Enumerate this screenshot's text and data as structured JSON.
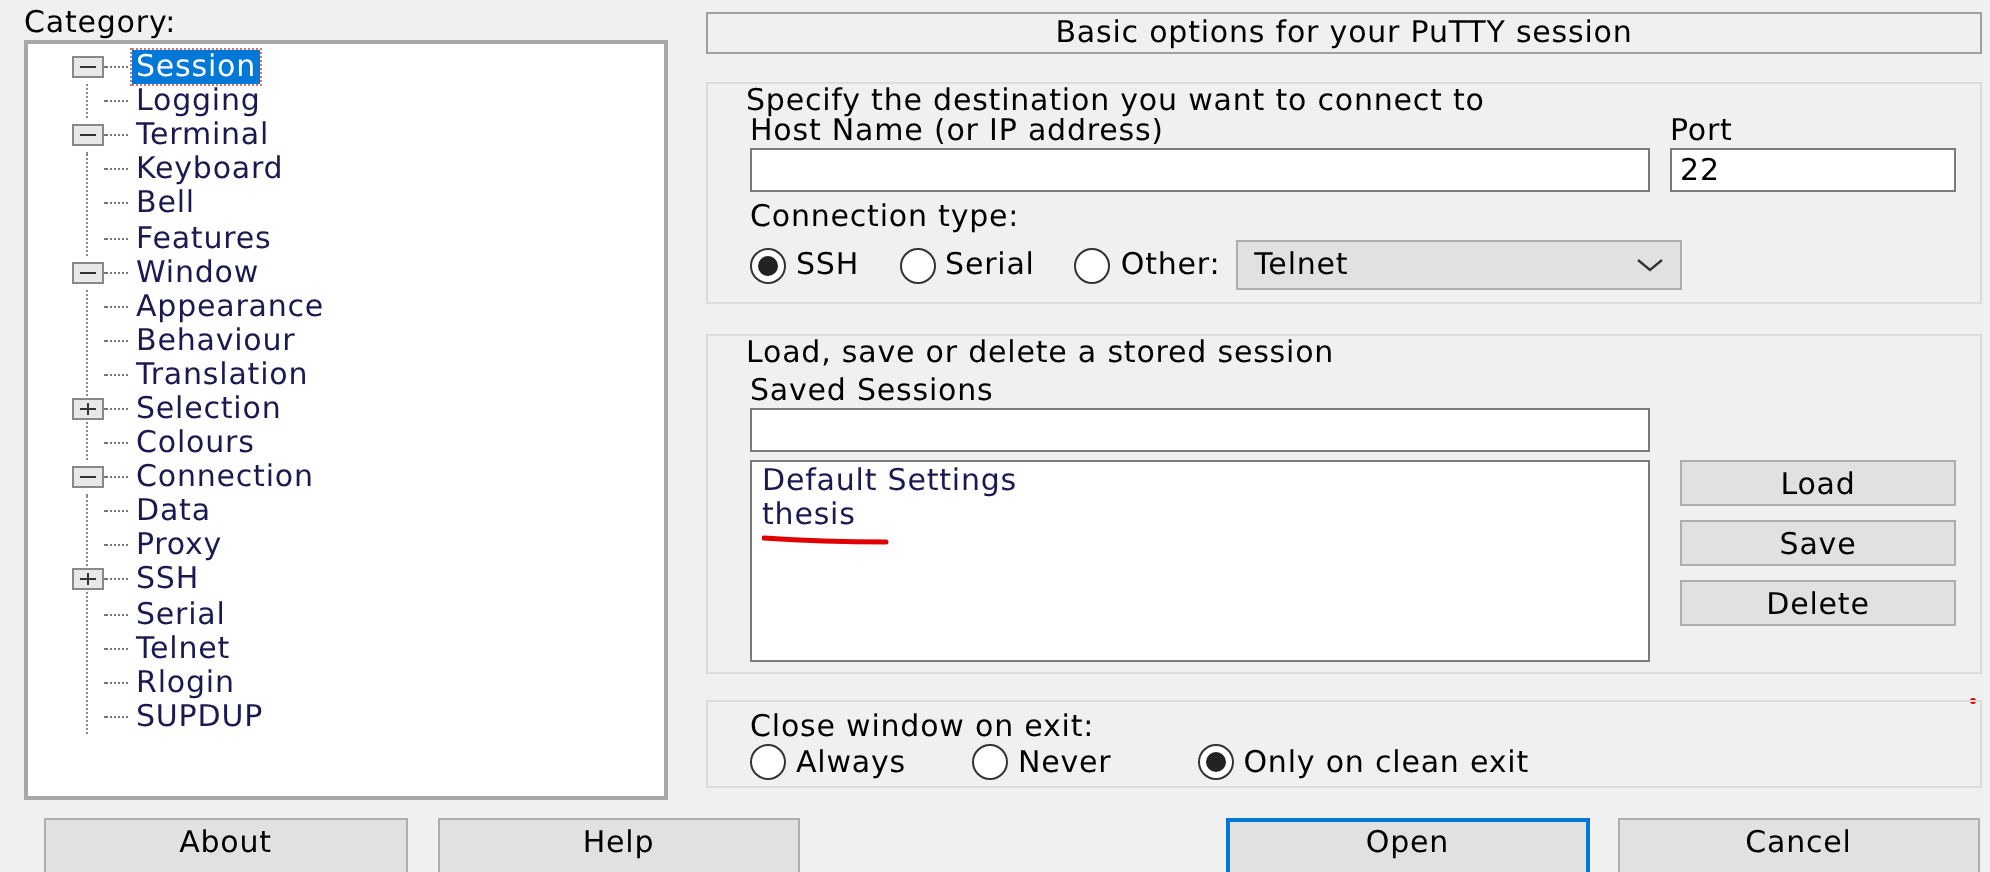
{
  "category_label": {
    "text": "Category:"
  },
  "tree": [
    {
      "label": "Session",
      "kind": "branch",
      "expanded": true,
      "selected": true,
      "children": [
        {
          "label": "Logging",
          "kind": "leaf",
          "selected": false
        }
      ]
    },
    {
      "label": "Terminal",
      "kind": "branch",
      "expanded": true,
      "selected": false,
      "children": [
        {
          "label": "Keyboard",
          "kind": "leaf",
          "selected": false
        },
        {
          "label": "Bell",
          "kind": "leaf",
          "selected": false
        },
        {
          "label": "Features",
          "kind": "leaf",
          "selected": false
        }
      ]
    },
    {
      "label": "Window",
      "kind": "branch",
      "expanded": true,
      "selected": false,
      "children": [
        {
          "label": "Appearance",
          "kind": "leaf",
          "selected": false
        },
        {
          "label": "Behaviour",
          "kind": "leaf",
          "selected": false
        },
        {
          "label": "Translation",
          "kind": "leaf",
          "selected": false
        },
        {
          "label": "Selection",
          "kind": "branch",
          "expanded": false,
          "selected": false
        },
        {
          "label": "Colours",
          "kind": "leaf",
          "selected": false
        }
      ]
    },
    {
      "label": "Connection",
      "kind": "branch",
      "expanded": true,
      "selected": false,
      "children": [
        {
          "label": "Data",
          "kind": "leaf",
          "selected": false
        },
        {
          "label": "Proxy",
          "kind": "leaf",
          "selected": false
        },
        {
          "label": "SSH",
          "kind": "branch",
          "expanded": false,
          "selected": false
        },
        {
          "label": "Serial",
          "kind": "leaf",
          "selected": false
        },
        {
          "label": "Telnet",
          "kind": "leaf",
          "selected": false
        },
        {
          "label": "Rlogin",
          "kind": "leaf",
          "selected": false
        },
        {
          "label": "SUPDUP",
          "kind": "leaf",
          "selected": false
        }
      ]
    }
  ],
  "panel_title": "Basic options for your PuTTY session",
  "destination": {
    "legend": "Specify the destination you want to connect to",
    "host_label": {
      "text": "Host Name (or IP address)"
    },
    "port_label": {
      "text": "Port"
    },
    "port_value": "22",
    "connection_type_label": "Connection type:",
    "connection_types": [
      {
        "label": "SSH",
        "selected": true
      },
      {
        "label": "Serial",
        "selected": false
      },
      {
        "label": "Other:",
        "selected": false
      }
    ],
    "other_protocol": "Telnet"
  },
  "stored": {
    "legend": "Load, save or delete a stored session",
    "saved_label": {
      "text": "Saved Sessions"
    },
    "sessions": [
      {
        "label": "Default Settings"
      },
      {
        "label": "thesis",
        "annotated": true
      }
    ],
    "buttons": [
      {
        "label": "Load"
      },
      {
        "label": "Save"
      },
      {
        "label": "Delete"
      }
    ]
  },
  "close_on_exit": {
    "label": {
      "text": "Close window on exit:"
    },
    "options": [
      {
        "label": "Always",
        "selected": false
      },
      {
        "label": "Never",
        "selected": false
      },
      {
        "label": "Only on clean exit",
        "selected": true
      }
    ]
  },
  "footer_buttons": [
    {
      "label": "About",
      "focused": false
    },
    {
      "label": "Help",
      "focused": false
    },
    {
      "label": "Open",
      "focused": true
    },
    {
      "label": "Cancel",
      "focused": false
    }
  ]
}
